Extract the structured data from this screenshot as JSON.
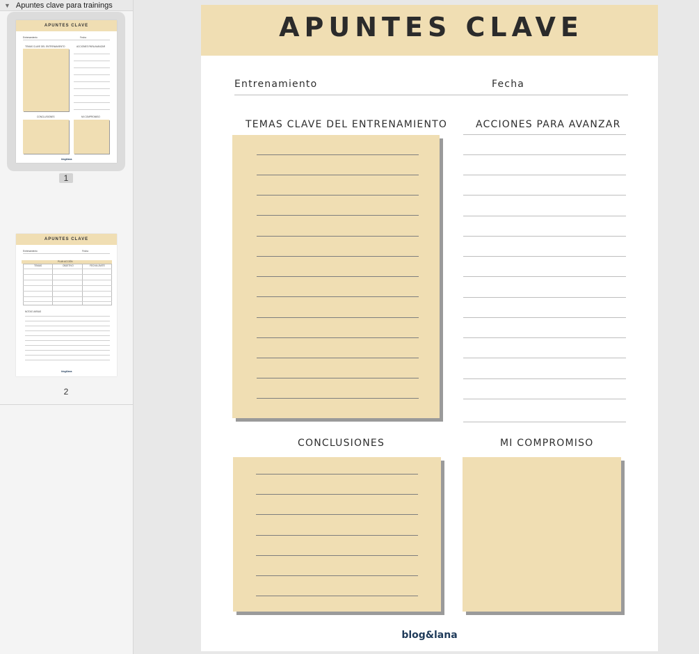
{
  "sidebar": {
    "doc_title": "Apuntes clave para trainings",
    "pages": [
      "1",
      "2"
    ]
  },
  "page": {
    "title": "APUNTES CLAVE",
    "field_training": "Entrenamiento",
    "field_date": "Fecha",
    "section_topics": "TEMAS CLAVE DEL ENTRENAMIENTO",
    "section_actions": "ACCIONES PARA AVANZAR",
    "section_conclusions": "CONCLUSIONES",
    "section_commitment": "MI COMPROMISO",
    "footer_logo": "blog&lana"
  },
  "thumb2": {
    "title": "APUNTES CLAVE",
    "field_training": "Entrenamiento",
    "field_date": "Fecha",
    "plan": "PLAN ACCIÓN",
    "col1": "TEMAS",
    "col2": "OBJETIVO",
    "col3": "FECHA LÍMITE",
    "notes": "NOTAS VARIAS",
    "logo": "blog&lana"
  },
  "colors": {
    "accent": "#f0deb3",
    "logo": "#1f3b5a"
  }
}
